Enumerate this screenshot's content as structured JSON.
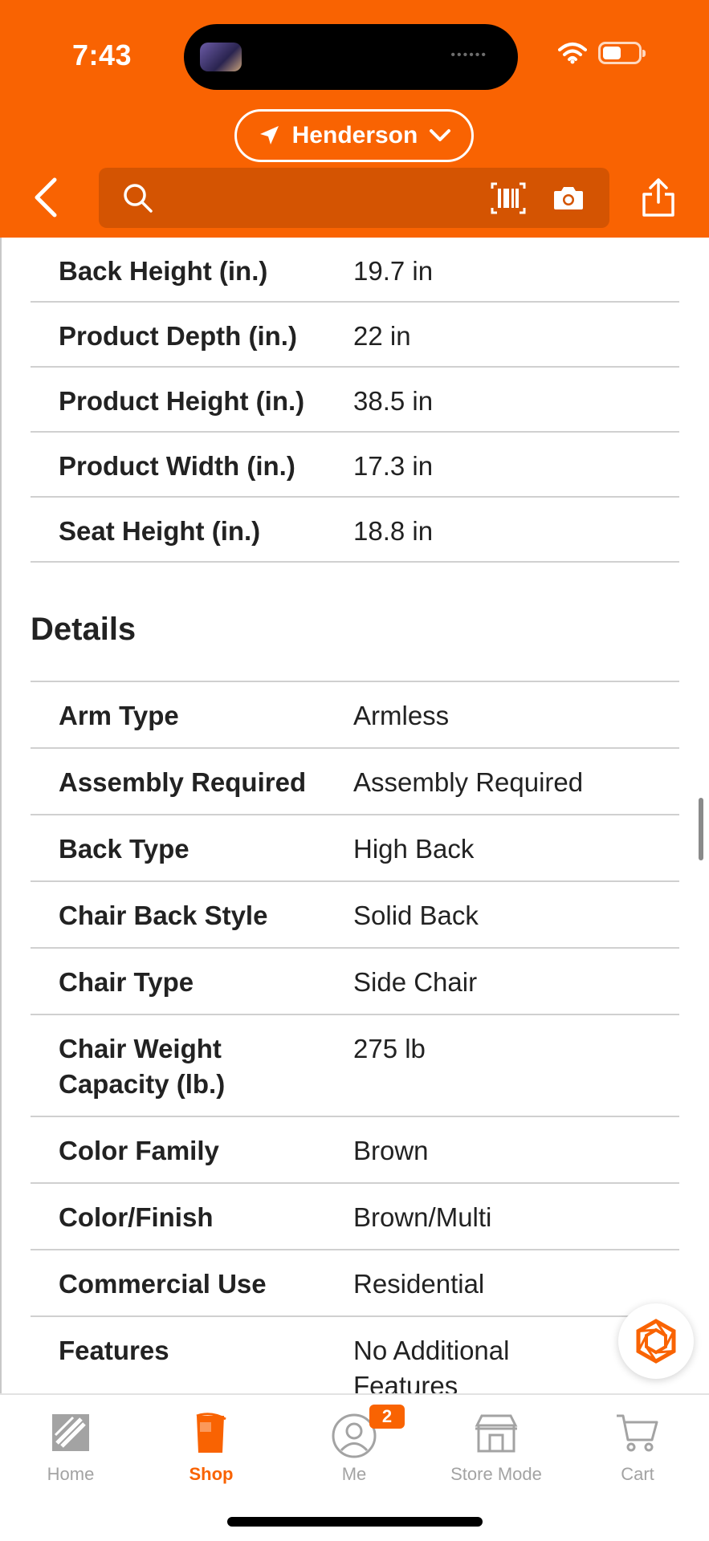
{
  "status_bar": {
    "time": "7:43"
  },
  "header": {
    "location": "Henderson",
    "search": {
      "value": "",
      "placeholder": ""
    }
  },
  "dimensions": [
    {
      "label": "Back Height (in.)",
      "value": "19.7 in"
    },
    {
      "label": "Product Depth (in.)",
      "value": "22 in"
    },
    {
      "label": "Product Height (in.)",
      "value": "38.5 in"
    },
    {
      "label": "Product Width (in.)",
      "value": "17.3 in"
    },
    {
      "label": "Seat Height (in.)",
      "value": "18.8 in"
    }
  ],
  "details": {
    "title": "Details",
    "rows": [
      {
        "label": "Arm Type",
        "value": "Armless"
      },
      {
        "label": "Assembly Required",
        "value": "Assembly Required"
      },
      {
        "label": "Back Type",
        "value": "High Back"
      },
      {
        "label": "Chair Back Style",
        "value": "Solid Back"
      },
      {
        "label": "Chair Type",
        "value": "Side Chair"
      },
      {
        "label": "Chair Weight Capacity (lb.)",
        "value": "275 lb"
      },
      {
        "label": "Color Family",
        "value": "Brown"
      },
      {
        "label": "Color/Finish",
        "value": "Brown/Multi"
      },
      {
        "label": "Commercial Use",
        "value": "Residential"
      },
      {
        "label": "Features",
        "value": "No Additional Features"
      }
    ]
  },
  "tabbar": {
    "items": [
      {
        "label": "Home",
        "icon": "home-depot-logo-icon"
      },
      {
        "label": "Shop",
        "icon": "bucket-icon"
      },
      {
        "label": "Me",
        "icon": "user-icon"
      },
      {
        "label": "Store Mode",
        "icon": "store-icon"
      },
      {
        "label": "Cart",
        "icon": "cart-icon"
      }
    ],
    "active": "Shop",
    "me_badge": "2"
  },
  "colors": {
    "brand_orange": "#f96302",
    "search_bg": "#d45402",
    "divider": "#d0d0d0",
    "inactive_tab": "#a3a3a3"
  }
}
